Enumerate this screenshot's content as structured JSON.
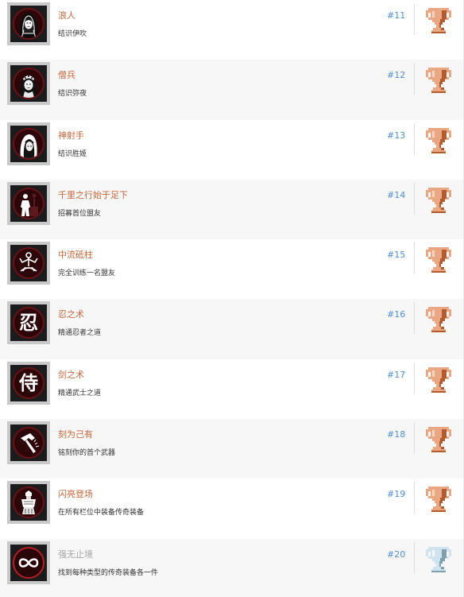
{
  "achievements": [
    {
      "title": "浪人",
      "description": "结识伊吹",
      "number": "#11",
      "unlocked": true,
      "trophy": "bronze",
      "icon": "ibuki-portrait-icon"
    },
    {
      "title": "僧兵",
      "description": "结识弥夜",
      "number": "#12",
      "unlocked": true,
      "trophy": "bronze",
      "icon": "miya-portrait-icon"
    },
    {
      "title": "神射手",
      "description": "结识胜姬",
      "number": "#13",
      "unlocked": true,
      "trophy": "bronze",
      "icon": "katsuhime-portrait-icon"
    },
    {
      "title": "千里之行始于足下",
      "description": "招募首位盟友",
      "number": "#14",
      "unlocked": true,
      "trophy": "bronze",
      "icon": "ally-silhouette-icon"
    },
    {
      "title": "中流砥柱",
      "description": "完全训练一名盟友",
      "number": "#15",
      "unlocked": true,
      "trophy": "bronze",
      "icon": "meditating-figure-icon"
    },
    {
      "title": "忍之术",
      "description": "精通忍者之道",
      "number": "#16",
      "unlocked": true,
      "trophy": "bronze",
      "icon": "nin-kanji-icon",
      "glyph": "忍"
    },
    {
      "title": "剑之术",
      "description": "精通武士之道",
      "number": "#17",
      "unlocked": true,
      "trophy": "bronze",
      "icon": "samurai-kanji-icon",
      "glyph": "侍"
    },
    {
      "title": "刻为己有",
      "description": "铭刻你的首个武器",
      "number": "#18",
      "unlocked": true,
      "trophy": "bronze",
      "icon": "hammer-icon"
    },
    {
      "title": "闪亮登场",
      "description": "在所有栏位中装备传奇装备",
      "number": "#19",
      "unlocked": true,
      "trophy": "bronze",
      "icon": "armored-warrior-icon"
    },
    {
      "title": "强无止境",
      "description": "找到每种类型的传奇装备各一件",
      "number": "#20",
      "unlocked": false,
      "trophy": "silver",
      "icon": "infinity-icon"
    }
  ],
  "colors": {
    "title_active": "#c7673b",
    "title_inactive": "#a4a4a4",
    "number": "#4f8fd6",
    "bronze_light": "#e9a784",
    "bronze_dark": "#b35a2f",
    "silver_light": "#cfe3ee",
    "silver_dark": "#7f9eae"
  }
}
